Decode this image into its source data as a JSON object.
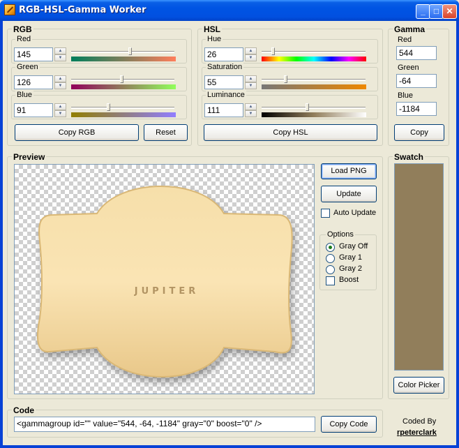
{
  "window": {
    "title": "RGB-HSL-Gamma Worker"
  },
  "titlebar_buttons": {
    "minimize": "_",
    "maximize": "□",
    "close": "✕"
  },
  "rgb": {
    "legend": "RGB",
    "red": {
      "label": "Red",
      "value": "145",
      "slider_fraction": 0.57
    },
    "green": {
      "label": "Green",
      "value": "126",
      "slider_fraction": 0.49
    },
    "blue": {
      "label": "Blue",
      "value": "91",
      "slider_fraction": 0.36
    },
    "copy_label": "Copy RGB",
    "reset_label": "Reset"
  },
  "hsl": {
    "legend": "HSL",
    "hue": {
      "label": "Hue",
      "value": "26",
      "slider_fraction": 0.1
    },
    "saturation": {
      "label": "Saturation",
      "value": "55",
      "slider_fraction": 0.22
    },
    "luminance": {
      "label": "Luminance",
      "value": "111",
      "slider_fraction": 0.44
    },
    "copy_label": "Copy HSL"
  },
  "gamma": {
    "legend": "Gamma",
    "red": {
      "label": "Red",
      "value": "544"
    },
    "green": {
      "label": "Green",
      "value": "-64"
    },
    "blue": {
      "label": "Blue",
      "value": "-1184"
    },
    "copy_label": "Copy"
  },
  "preview": {
    "legend": "Preview",
    "image_text": "JUPITER",
    "load_png_label": "Load PNG",
    "update_label": "Update",
    "auto_update_label": "Auto Update",
    "auto_update_checked": false
  },
  "options": {
    "legend": "Options",
    "items": [
      {
        "label": "Gray Off",
        "selected": true
      },
      {
        "label": "Gray 1",
        "selected": false
      },
      {
        "label": "Gray 2",
        "selected": false
      }
    ],
    "boost_label": "Boost",
    "boost_checked": false
  },
  "swatch": {
    "legend": "Swatch",
    "color": "#917e5b",
    "color_picker_label": "Color Picker"
  },
  "code": {
    "legend": "Code",
    "value": "<gammagroup id=\"\" value=\"544, -64, -1184\" gray=\"0\" boost=\"0\" />",
    "copy_label": "Copy Code"
  },
  "credits": {
    "coded_by": "Coded By",
    "author": "rpeterclark"
  }
}
